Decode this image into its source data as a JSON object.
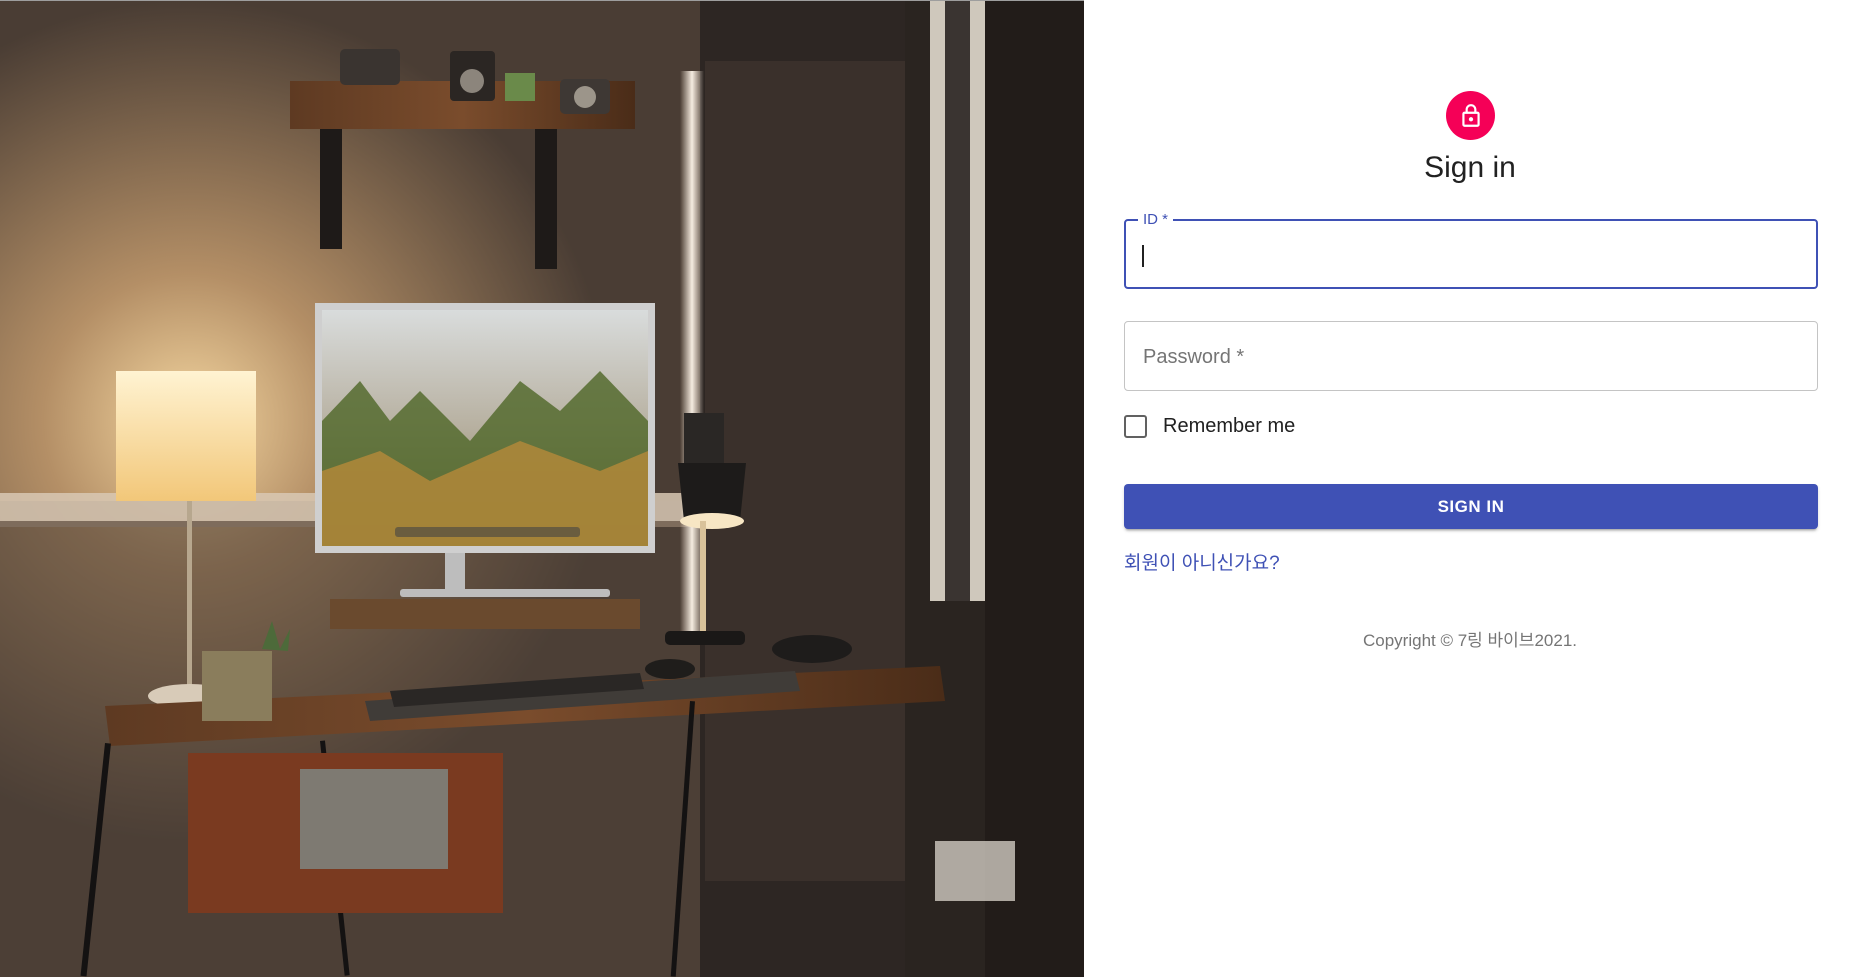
{
  "page": {
    "background_image": "home-office-desk-photo",
    "accent_color": "#3f51b5",
    "avatar_color": "#f50057"
  },
  "header": {
    "icon": "lock-icon",
    "title": "Sign in"
  },
  "form": {
    "id_field": {
      "label": "ID *",
      "value": ""
    },
    "password_field": {
      "label": "Password *",
      "value": ""
    },
    "remember_label": "Remember me",
    "remember_checked": false,
    "submit_label": "SIGN IN",
    "signup_link": "회원이 아니신가요?"
  },
  "footer": {
    "copyright": "Copyright © 7링 바이브2021."
  }
}
